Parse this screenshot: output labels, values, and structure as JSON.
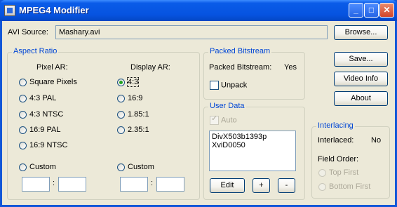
{
  "window": {
    "title": "MPEG4 Modifier",
    "min": "_",
    "max": "□",
    "close": "✕"
  },
  "source": {
    "label": "AVI Source:",
    "value": "Mashary.avi",
    "browse": "Browse..."
  },
  "buttons": {
    "save": "Save...",
    "video_info": "Video Info",
    "about": "About"
  },
  "aspect": {
    "title": "Aspect Ratio",
    "pixel_header": "Pixel AR:",
    "display_header": "Display AR:",
    "pixel_options": [
      "Square Pixels",
      "4:3 PAL",
      "4:3 NTSC",
      "16:9 PAL",
      "16:9 NTSC",
      "Custom"
    ],
    "display_options": [
      "4:3",
      "16:9",
      "1.85:1",
      "2.35:1",
      "Custom"
    ],
    "selected_display": "4:3"
  },
  "packed": {
    "title": "Packed Bitstream",
    "label": "Packed Bitstream:",
    "value": "Yes",
    "unpack": "Unpack"
  },
  "userdata": {
    "title": "User Data",
    "auto": "Auto",
    "items": [
      "DivX503b1393p",
      "XviD0050"
    ],
    "edit": "Edit",
    "plus": "+",
    "minus": "-"
  },
  "interlacing": {
    "title": "Interlacing",
    "label": "Interlaced:",
    "value": "No",
    "field_order": "Field Order:",
    "top_first": "Top First",
    "bottom_first": "Bottom First"
  }
}
